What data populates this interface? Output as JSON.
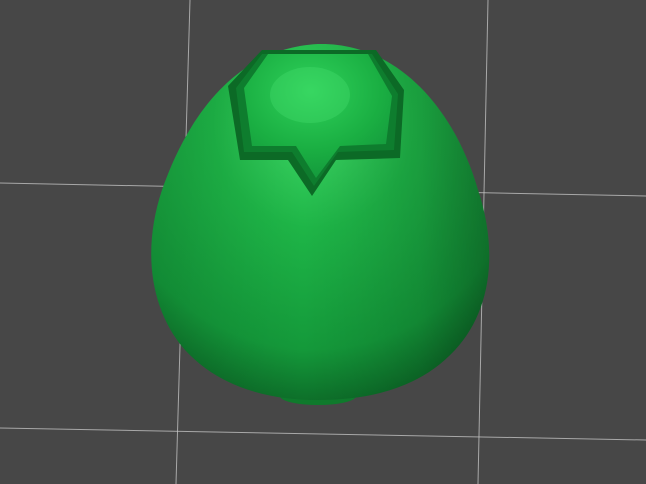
{
  "viewport": {
    "background_color": "#474747",
    "grid_color": "#c8c8c8",
    "grid_visible": true
  },
  "model": {
    "shape": "egg-with-star-cutout",
    "body_color": "#16a13a",
    "body_highlight_color": "#3fd866",
    "body_shadow_color": "#0a5c22",
    "cutout_rim_color": "#0c6a26",
    "selected": false
  }
}
